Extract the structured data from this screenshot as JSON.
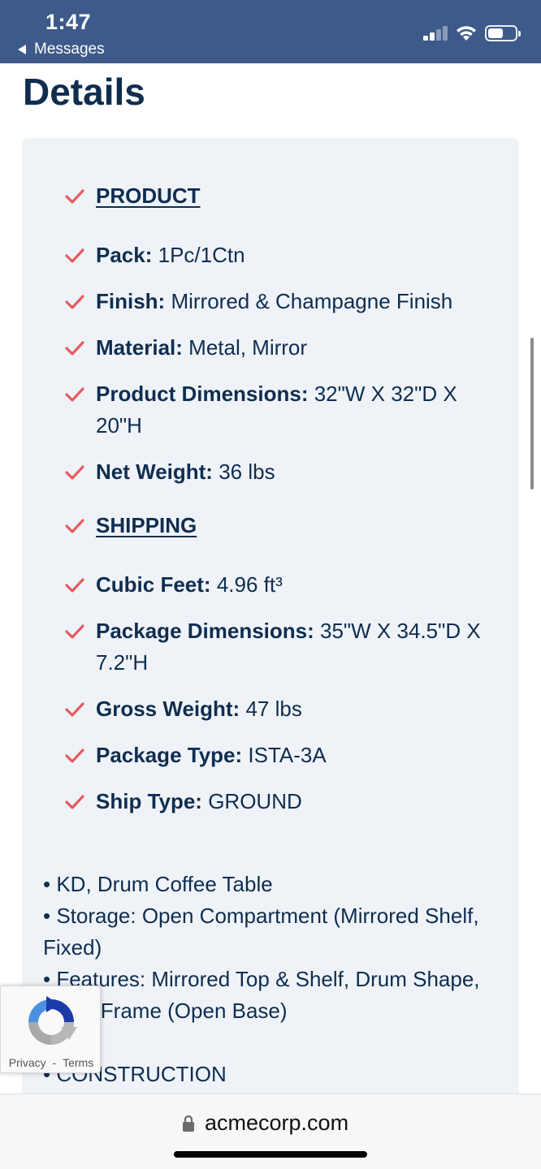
{
  "status_bar": {
    "time": "1:47",
    "back_label": "Messages",
    "battery_level": 0.55,
    "signal_bars_active": 2,
    "signal_bars_total": 4,
    "color": "#3d5a8a"
  },
  "page": {
    "title": "Details"
  },
  "colors": {
    "check": "#e65b5f",
    "text": "#0f2d4f",
    "card_bg": "#eff3f8"
  },
  "details": {
    "product_heading": "PRODUCT",
    "pack": {
      "label": "Pack:",
      "value": "1Pc/1Ctn"
    },
    "finish": {
      "label": "Finish:",
      "value": "Mirrored & Champagne Finish"
    },
    "material": {
      "label": "Material:",
      "value": "Metal, Mirror"
    },
    "product_dimensions": {
      "label": "Product Dimensions:",
      "value": "32\"W X 32\"D X 20\"H"
    },
    "net_weight": {
      "label": "Net Weight:",
      "value": "36 lbs"
    },
    "shipping_heading": "SHIPPING",
    "cubic_feet": {
      "label": "Cubic Feet:",
      "value": "4.96 ft³"
    },
    "package_dimensions": {
      "label": "Package Dimensions:",
      "value": "35\"W X 34.5\"D X 7.2\"H"
    },
    "gross_weight": {
      "label": "Gross Weight:",
      "value": "47 lbs"
    },
    "package_type": {
      "label": "Package Type:",
      "value": "ISTA-3A"
    },
    "ship_type": {
      "label": "Ship Type:",
      "value": "GROUND"
    }
  },
  "bullets": {
    "line1": "• KD, Drum Coffee Table",
    "line2": "• Storage: Open Compartment (Mirrored Shelf, Fixed)",
    "line3": "• Features: Mirrored Top & Shelf, Drum Shape, Metal Frame (Open Base)",
    "line4": "• CONSTRUCTION"
  },
  "recaptcha": {
    "privacy": "Privacy",
    "separator": "-",
    "terms": "Terms"
  },
  "browser": {
    "url": "acmecorp.com"
  }
}
